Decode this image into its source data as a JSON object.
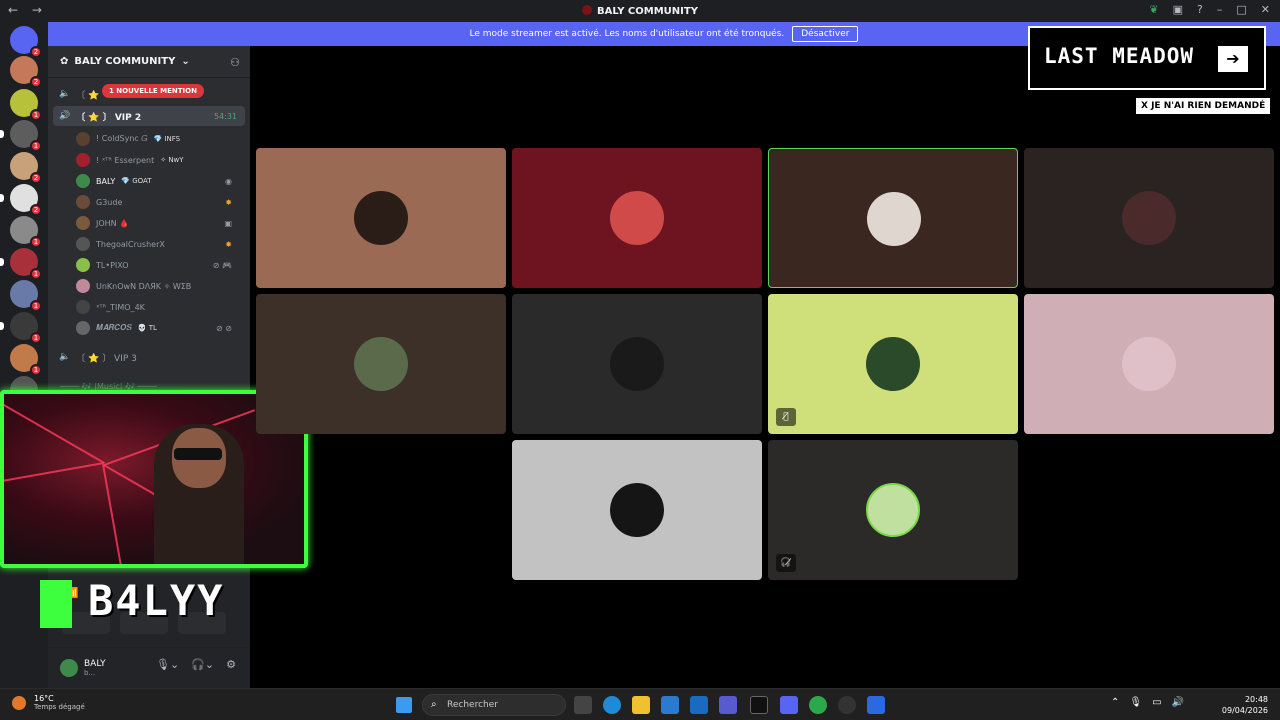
{
  "window": {
    "title": "BALY COMMUNITY"
  },
  "banner": {
    "text": "Le mode streamer est activé. Les noms d'utilisateur ont été tronqués.",
    "button": "Désactiver"
  },
  "server": {
    "name": "BALY COMMUNITY"
  },
  "guild_badges": [
    "2",
    "2",
    "1",
    "1",
    "2",
    "2",
    "1",
    "1",
    "1",
    "1",
    "1",
    "1"
  ],
  "channels": {
    "mention": "1 NOUVELLE MENTION",
    "vip2": {
      "label": "〔 ⭐ 〕 VIP 2",
      "time": "54:31"
    },
    "vip3": {
      "label": "〔 ⭐ 〕 VIP 3"
    },
    "music": "──── 🎶 |Music| 🎶 ────"
  },
  "members": [
    {
      "name": "! ColdSync 𝐺",
      "tag": "💎 INFS"
    },
    {
      "name": "! ˣᵀᴿ Esserpent",
      "tag": "✧ NwY"
    },
    {
      "name": "BALY",
      "tag": "💎 GOAT"
    },
    {
      "name": "G3ude",
      "tag": ""
    },
    {
      "name": "JOHN 🩸",
      "tag": ""
    },
    {
      "name": "ThegoalCrusherX",
      "tag": ""
    },
    {
      "name": "TL•PIXO",
      "tag": ""
    },
    {
      "name": "UnKnOwN DΛЯK ✧ WΣB",
      "tag": ""
    },
    {
      "name": "ˣᵀᴿ_TIMO_4K",
      "tag": ""
    },
    {
      "name": "𝑴𝑨𝑹𝑪𝑶𝑺",
      "tag": "💀 TL"
    }
  ],
  "user": {
    "name": "BALY",
    "status": "b..."
  },
  "overlay": {
    "brand": "B4LYY",
    "game": "LAST MEADOW",
    "note": "X JE N'AI RIEN DEMANDÉ"
  },
  "taskbar": {
    "weather_temp": "16°C",
    "weather_desc": "Temps dégagé",
    "search": "Rechercher",
    "time": "20:48",
    "date": "09/04/2026"
  },
  "colors": {
    "accent": "#5865f2",
    "speaking": "#5bd65b",
    "danger": "#da373c"
  }
}
